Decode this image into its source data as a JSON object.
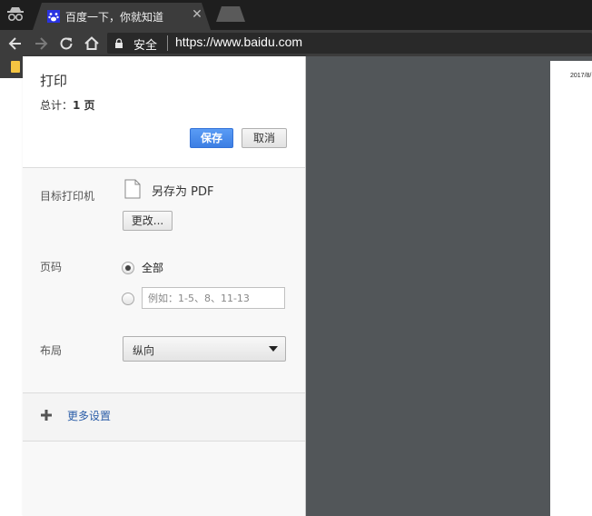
{
  "browser": {
    "tab": {
      "title": "百度一下，你就知道",
      "close_glyph": "✕",
      "favicon": "baidu-paw-icon"
    },
    "omnibox": {
      "secure_label": "安全",
      "url": "https://www.baidu.com"
    },
    "icons": [
      "incognito-icon",
      "back-icon",
      "forward-icon",
      "reload-icon",
      "home-icon",
      "lock-icon",
      "bookmark-folder-icon"
    ]
  },
  "print_dialog": {
    "title": "打印",
    "total_label": "总计：",
    "total_value": "1 页",
    "save_label": "保存",
    "cancel_label": "取消",
    "destination": {
      "label": "目标打印机",
      "name": "另存为 PDF",
      "change_label": "更改..."
    },
    "pages": {
      "label": "页码",
      "all_label": "全部",
      "custom_placeholder": "例如：1-5、8、11-13",
      "selected": "全部"
    },
    "layout": {
      "label": "布局",
      "value": "纵向"
    },
    "more_settings_label": "更多设置"
  },
  "preview": {
    "date_text": "2017/8/"
  },
  "colors": {
    "accent": "#4a8af4",
    "chrome_dark": "#3c3c3c",
    "preview_bg": "#525659",
    "link": "#2c5ea8"
  }
}
